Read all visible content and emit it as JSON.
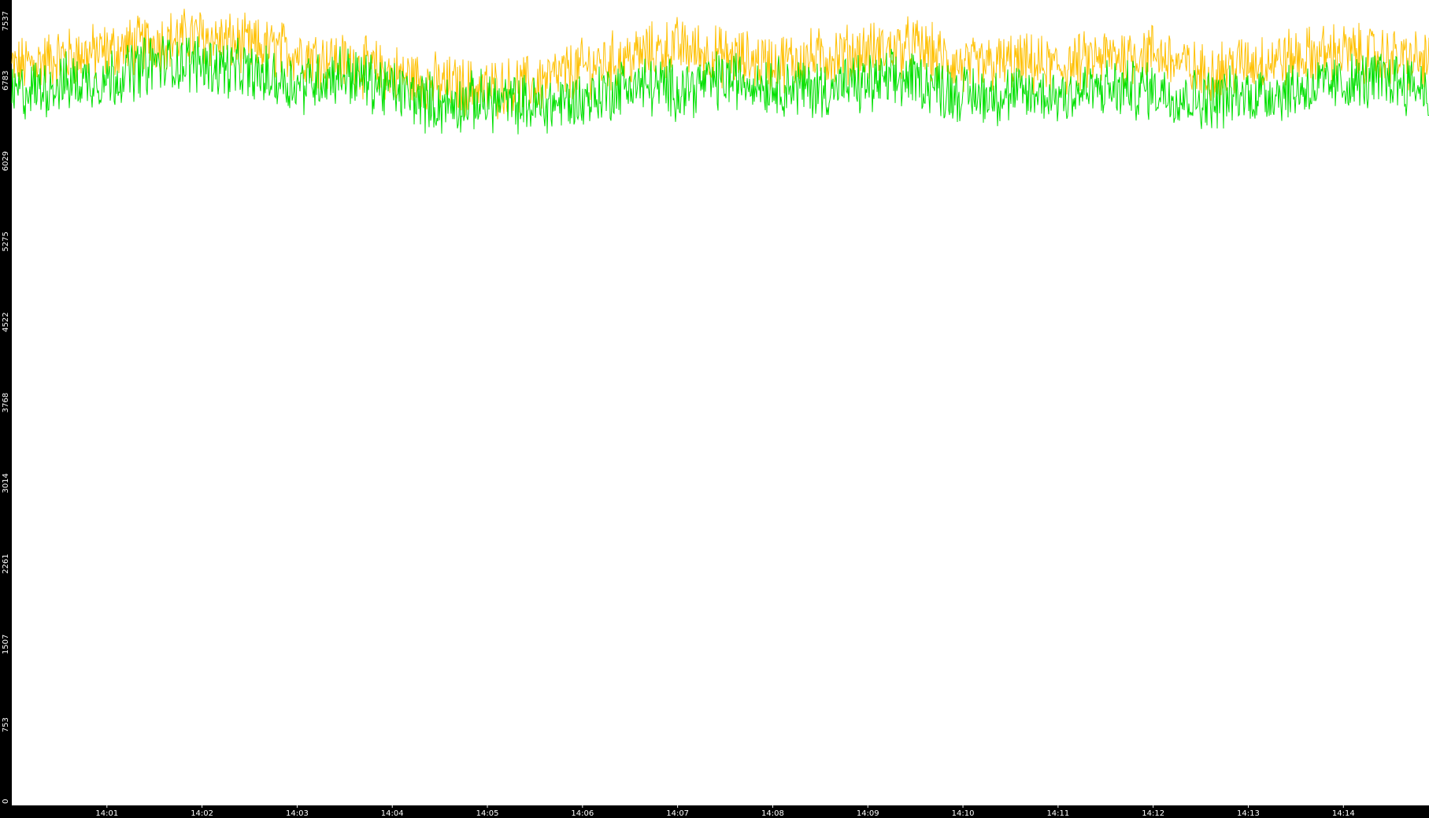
{
  "chart_data": {
    "type": "line",
    "title": "",
    "xlabel": "",
    "ylabel": "",
    "ylim": [
      0,
      7537
    ],
    "yticks": [
      "0",
      "753",
      "1507",
      "2261",
      "3014",
      "3768",
      "4522",
      "5275",
      "6029",
      "6783",
      "7537"
    ],
    "xticks": [
      "14:01",
      "14:02",
      "14:03",
      "14:04",
      "14:05",
      "14:06",
      "14:07",
      "14:08",
      "14:09",
      "14:10",
      "14:11",
      "14:12",
      "14:13",
      "14:14"
    ],
    "x_range_minutes": [
      0,
      14.9
    ],
    "grid": false,
    "legend": "none",
    "colors": {
      "background": "#000000",
      "plot_background": "#ffffff",
      "axis_text": "#ffffff"
    },
    "series": [
      {
        "color": "#ffc000",
        "x": [
          0,
          0.5,
          1,
          1.5,
          2,
          2.5,
          3,
          3.5,
          4,
          4.5,
          5,
          5.5,
          6,
          6.5,
          7,
          7.5,
          8,
          8.5,
          9,
          9.5,
          10,
          10.5,
          11,
          11.5,
          12,
          12.5,
          13,
          13.5,
          14,
          14.5,
          14.9
        ],
        "values": [
          6900,
          7000,
          7050,
          7150,
          7200,
          7100,
          7050,
          6950,
          6850,
          6750,
          6700,
          6750,
          6900,
          7000,
          7100,
          7000,
          6950,
          7000,
          7050,
          7100,
          6900,
          6950,
          6900,
          7000,
          7050,
          6850,
          6950,
          7000,
          7050,
          7000,
          6950
        ]
      },
      {
        "color": "#00e000",
        "x": [
          0,
          0.5,
          1,
          1.5,
          2,
          2.5,
          3,
          3.5,
          4,
          4.5,
          5,
          5.5,
          6,
          6.5,
          7,
          7.5,
          8,
          8.5,
          9,
          9.5,
          10,
          10.5,
          11,
          11.5,
          12,
          12.5,
          13,
          13.5,
          14,
          14.5,
          14.9
        ],
        "values": [
          6650,
          6750,
          6800,
          6950,
          6950,
          6850,
          6750,
          6850,
          6700,
          6550,
          6600,
          6550,
          6600,
          6750,
          6700,
          6800,
          6750,
          6700,
          6750,
          6800,
          6650,
          6650,
          6650,
          6700,
          6700,
          6600,
          6650,
          6700,
          6750,
          6800,
          6700
        ]
      }
    ]
  }
}
